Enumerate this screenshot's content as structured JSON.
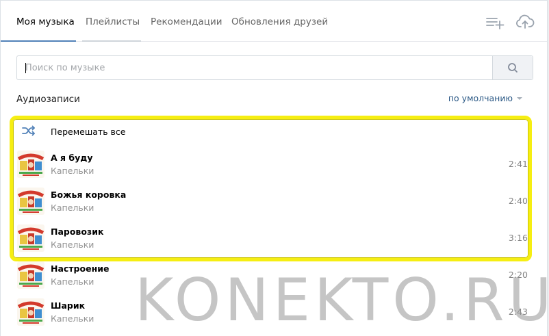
{
  "tabs": [
    {
      "label": "Моя музыка",
      "active": true
    },
    {
      "label": "Плейлисты",
      "active": false
    },
    {
      "label": "Рекомендации",
      "active": false
    },
    {
      "label": "Обновления друзей",
      "active": false
    }
  ],
  "header_icons": [
    "add-playlist-icon",
    "upload-cloud-icon"
  ],
  "search": {
    "placeholder": "Поиск по музыке",
    "value": "",
    "button_icon": "search-icon"
  },
  "section": {
    "title": "Аудиозаписи",
    "sort_label": "по умолчанию"
  },
  "shuffle": {
    "label": "Перемешать все",
    "icon": "shuffle-icon"
  },
  "tracks": [
    {
      "title": "А я буду",
      "artist": "Капельки",
      "duration": "2:41"
    },
    {
      "title": "Божья коровка",
      "artist": "Капельки",
      "duration": "2:40"
    },
    {
      "title": "Паровозик",
      "artist": "Капельки",
      "duration": "3:16"
    },
    {
      "title": "Настроение",
      "artist": "Капельки",
      "duration": "2:20"
    },
    {
      "title": "Шарик",
      "artist": "Капельки",
      "duration": "2:43"
    }
  ],
  "watermark": "KONEKTO.RU",
  "colors": {
    "accent": "#5181b8",
    "link": "#2a5885",
    "highlight": "#f6ee12",
    "muted": "#939393"
  }
}
